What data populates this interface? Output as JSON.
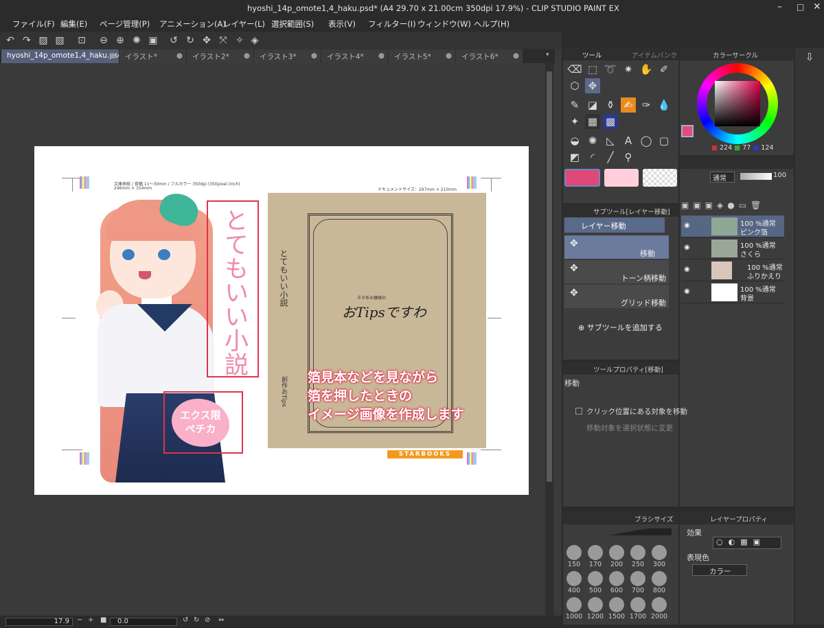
{
  "window": {
    "title": "hyoshi_14p_omote1,4_haku.psd* (A4 29.70 x 21.00cm 350dpi 17.9%)  - CLIP STUDIO PAINT EX"
  },
  "menu": [
    "ファイル(F)",
    "編集(E)",
    "ページ管理(P)",
    "アニメーション(A)",
    "レイヤー(L)",
    "選択範囲(S)",
    "表示(V)",
    "フィルター(I)",
    "ウィンドウ(W)",
    "ヘルプ(H)"
  ],
  "tabs": [
    "hyoshi_14p_omote1,4_haku.psd*",
    "イラスト*",
    "イラスト2*",
    "イラスト3*",
    "イラスト4*",
    "イラスト5*",
    "イラスト6*"
  ],
  "canvas": {
    "spec_line1": "文庫表紙 / 背幅 11～30mm / フルカラー 350dpi (350pixel /inch)",
    "spec_line2": "246mm × 154mm",
    "doc_size": "ドキュメントサイズ：297mm × 210mm",
    "title_vertical": "とてもいい小説",
    "badge_text": "エクス限ペチカ",
    "spine_title": "とてもいい小説",
    "spine_author": "創作おTips",
    "book_title": "おTipsですわ",
    "book_subtitle": "ネタ系お嬢様の",
    "publisher": "STARBOOKS",
    "annotation": [
      "箔見本などを見ながら",
      "箔を押したときの",
      "イメージ画像を作成します"
    ]
  },
  "status": {
    "zoom": "17.9",
    "rotation": "0.0"
  },
  "tool_panel": {
    "tab_tool": "ツール",
    "tab_item": "アイテムバンク",
    "colors": {
      "main": "#e04878",
      "sub": "#ffd0dc"
    }
  },
  "color_panel": {
    "title": "カラーサークル",
    "r": "224",
    "g": "77",
    "b": "124",
    "hex": "#e04d7c"
  },
  "subtool": {
    "title": "サブツール[レイヤー移動]",
    "header": "レイヤー移動",
    "items": [
      "移動",
      "トーン柄移動",
      "グリッド移動"
    ],
    "add": "サブツールを追加する"
  },
  "tool_property": {
    "title": "ツールプロパティ[移動]",
    "name": "移動",
    "opt1": "クリック位置にある対象を移動",
    "opt2": "移動対象を選択状態に変更"
  },
  "layers": {
    "blend": "通常",
    "opacity": "100",
    "rows": [
      {
        "mode": "100 %通常",
        "name": "ピンク箔"
      },
      {
        "mode": "100 %通常",
        "name": "さくら"
      },
      {
        "mode": "100 %通常",
        "name": "ふりかえり"
      },
      {
        "mode": "100 %通常",
        "name": "背景"
      }
    ]
  },
  "brush_size": {
    "title": "ブラシサイズ",
    "sizes": [
      "150",
      "170",
      "200",
      "250",
      "300",
      "400",
      "500",
      "600",
      "700",
      "800",
      "1000",
      "1200",
      "1500",
      "1700",
      "2000"
    ]
  },
  "layer_property": {
    "title": "レイヤープロパティ",
    "effect": "効果",
    "color_label": "表現色",
    "color_value": "カラー"
  }
}
